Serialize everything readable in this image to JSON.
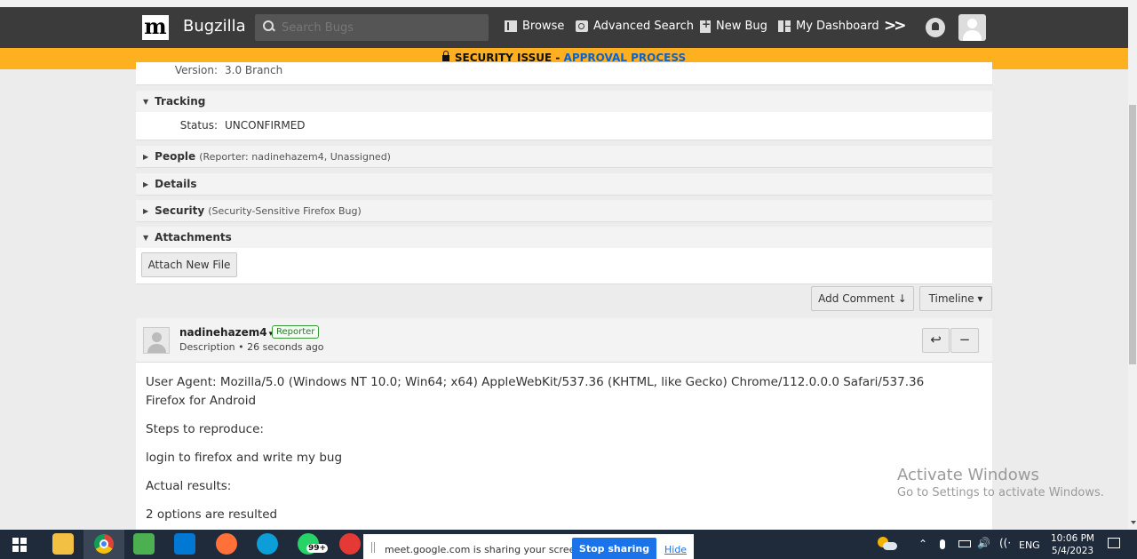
{
  "header": {
    "logo": "m",
    "brand": "Bugzilla",
    "search_placeholder": "Search Bugs",
    "nav": {
      "browse": "Browse",
      "advanced_search": "Advanced Search",
      "new_bug": "New Bug",
      "my_dashboard": "My Dashboard",
      "more": ">>"
    }
  },
  "banner": {
    "text": "SECURITY ISSUE - ",
    "link": "APPROVAL PROCESS"
  },
  "version_row": {
    "label": "Version:",
    "value": "3.0 Branch"
  },
  "sections": {
    "tracking": {
      "title": "Tracking",
      "status_label": "Status:",
      "status_value": "UNCONFIRMED"
    },
    "people": {
      "title": "People",
      "summary": "(Reporter: nadinehazem4, Unassigned)"
    },
    "details": {
      "title": "Details"
    },
    "security": {
      "title": "Security",
      "summary": "(Security-Sensitive Firefox Bug)"
    },
    "attachments": {
      "title": "Attachments",
      "attach_button": "Attach New File"
    }
  },
  "actions": {
    "add_comment": "Add Comment ↓",
    "timeline": "Timeline ▾"
  },
  "comment": {
    "user": "nadinehazem4",
    "user_caret": "▾",
    "badge": "Reporter",
    "meta": "Description • 26 seconds ago",
    "reply_icon": "↩",
    "collapse_icon": "−",
    "lines": [
      "User Agent: Mozilla/5.0 (Windows NT 10.0; Win64; x64) AppleWebKit/537.36 (KHTML, like Gecko) Chrome/112.0.0.0 Safari/537.36",
      "Firefox for Android"
    ],
    "steps_label": "Steps to reproduce:",
    "steps": "login to firefox and write my bug",
    "actual_label": "Actual results:",
    "actual": "2 options are resulted"
  },
  "watermark": {
    "line1": "Activate Windows",
    "line2": "Go to Settings to activate Windows."
  },
  "taskbar": {
    "share_message": "meet.google.com is sharing your screen.",
    "stop_sharing": "Stop sharing",
    "hide": "Hide",
    "whatsapp_badge": "99+",
    "lang": "ENG",
    "time": "10:06 PM",
    "date": "5/4/2023"
  },
  "colors": {
    "header_bg": "#3b3b3b",
    "banner_bg": "#ffb020",
    "link_blue": "#0e62c9",
    "reporter_green": "#3a9a3a",
    "taskbar_bg": "#1f2a3a",
    "meet_blue": "#1a73e8"
  }
}
